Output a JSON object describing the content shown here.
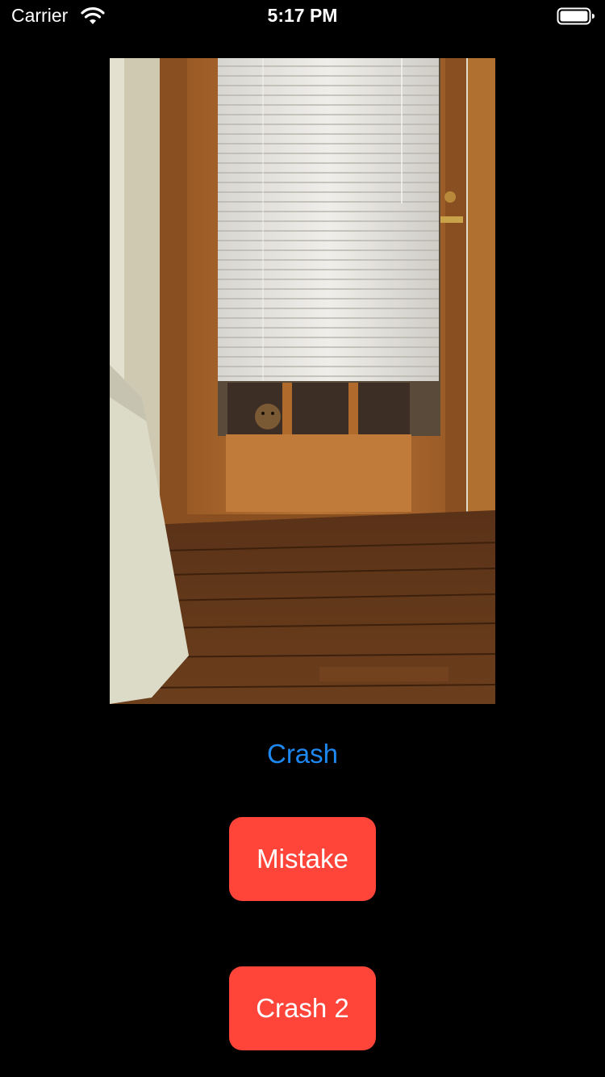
{
  "status_bar": {
    "carrier": "Carrier",
    "time": "5:17 PM",
    "wifi_icon": "wifi-icon",
    "battery_icon": "battery-full-icon"
  },
  "photo": {
    "subject": "door-with-blinds-and-cat-photo"
  },
  "buttons": {
    "crash_label": "Crash",
    "mistake_label": "Mistake",
    "crash2_label": "Crash 2"
  },
  "colors": {
    "background": "#000000",
    "link_blue": "#1e88f2",
    "button_red": "#ff453a",
    "text_white": "#ffffff"
  }
}
